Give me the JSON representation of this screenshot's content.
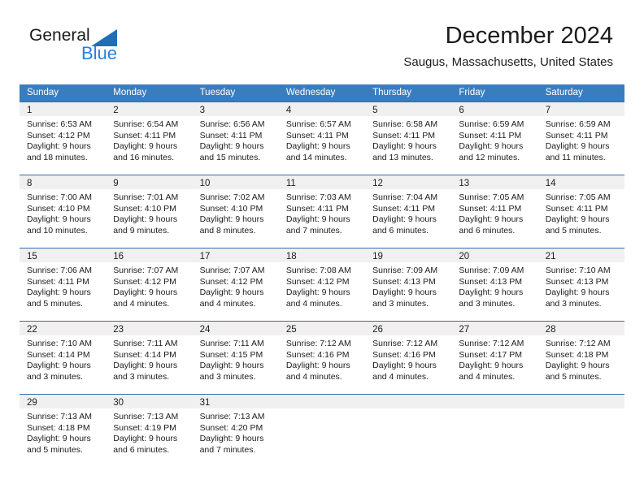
{
  "brand": {
    "name_part1": "General",
    "name_part2": "Blue",
    "triangle_color": "#1f6fb5",
    "blue_text_color": "#2980d9"
  },
  "header": {
    "title": "December 2024",
    "subtitle": "Saugus, Massachusetts, United States"
  },
  "theme": {
    "header_bar_color": "#3a7dbf",
    "row_divider_color": "#2f6fae",
    "day_band_color": "#f0f0f0",
    "text_color": "#1c1c1c"
  },
  "weekdays": [
    "Sunday",
    "Monday",
    "Tuesday",
    "Wednesday",
    "Thursday",
    "Friday",
    "Saturday"
  ],
  "weeks": [
    [
      {
        "day": "1",
        "sunrise": "Sunrise: 6:53 AM",
        "sunset": "Sunset: 4:12 PM",
        "daylight1": "Daylight: 9 hours",
        "daylight2": "and 18 minutes."
      },
      {
        "day": "2",
        "sunrise": "Sunrise: 6:54 AM",
        "sunset": "Sunset: 4:11 PM",
        "daylight1": "Daylight: 9 hours",
        "daylight2": "and 16 minutes."
      },
      {
        "day": "3",
        "sunrise": "Sunrise: 6:56 AM",
        "sunset": "Sunset: 4:11 PM",
        "daylight1": "Daylight: 9 hours",
        "daylight2": "and 15 minutes."
      },
      {
        "day": "4",
        "sunrise": "Sunrise: 6:57 AM",
        "sunset": "Sunset: 4:11 PM",
        "daylight1": "Daylight: 9 hours",
        "daylight2": "and 14 minutes."
      },
      {
        "day": "5",
        "sunrise": "Sunrise: 6:58 AM",
        "sunset": "Sunset: 4:11 PM",
        "daylight1": "Daylight: 9 hours",
        "daylight2": "and 13 minutes."
      },
      {
        "day": "6",
        "sunrise": "Sunrise: 6:59 AM",
        "sunset": "Sunset: 4:11 PM",
        "daylight1": "Daylight: 9 hours",
        "daylight2": "and 12 minutes."
      },
      {
        "day": "7",
        "sunrise": "Sunrise: 6:59 AM",
        "sunset": "Sunset: 4:11 PM",
        "daylight1": "Daylight: 9 hours",
        "daylight2": "and 11 minutes."
      }
    ],
    [
      {
        "day": "8",
        "sunrise": "Sunrise: 7:00 AM",
        "sunset": "Sunset: 4:10 PM",
        "daylight1": "Daylight: 9 hours",
        "daylight2": "and 10 minutes."
      },
      {
        "day": "9",
        "sunrise": "Sunrise: 7:01 AM",
        "sunset": "Sunset: 4:10 PM",
        "daylight1": "Daylight: 9 hours",
        "daylight2": "and 9 minutes."
      },
      {
        "day": "10",
        "sunrise": "Sunrise: 7:02 AM",
        "sunset": "Sunset: 4:10 PM",
        "daylight1": "Daylight: 9 hours",
        "daylight2": "and 8 minutes."
      },
      {
        "day": "11",
        "sunrise": "Sunrise: 7:03 AM",
        "sunset": "Sunset: 4:11 PM",
        "daylight1": "Daylight: 9 hours",
        "daylight2": "and 7 minutes."
      },
      {
        "day": "12",
        "sunrise": "Sunrise: 7:04 AM",
        "sunset": "Sunset: 4:11 PM",
        "daylight1": "Daylight: 9 hours",
        "daylight2": "and 6 minutes."
      },
      {
        "day": "13",
        "sunrise": "Sunrise: 7:05 AM",
        "sunset": "Sunset: 4:11 PM",
        "daylight1": "Daylight: 9 hours",
        "daylight2": "and 6 minutes."
      },
      {
        "day": "14",
        "sunrise": "Sunrise: 7:05 AM",
        "sunset": "Sunset: 4:11 PM",
        "daylight1": "Daylight: 9 hours",
        "daylight2": "and 5 minutes."
      }
    ],
    [
      {
        "day": "15",
        "sunrise": "Sunrise: 7:06 AM",
        "sunset": "Sunset: 4:11 PM",
        "daylight1": "Daylight: 9 hours",
        "daylight2": "and 5 minutes."
      },
      {
        "day": "16",
        "sunrise": "Sunrise: 7:07 AM",
        "sunset": "Sunset: 4:12 PM",
        "daylight1": "Daylight: 9 hours",
        "daylight2": "and 4 minutes."
      },
      {
        "day": "17",
        "sunrise": "Sunrise: 7:07 AM",
        "sunset": "Sunset: 4:12 PM",
        "daylight1": "Daylight: 9 hours",
        "daylight2": "and 4 minutes."
      },
      {
        "day": "18",
        "sunrise": "Sunrise: 7:08 AM",
        "sunset": "Sunset: 4:12 PM",
        "daylight1": "Daylight: 9 hours",
        "daylight2": "and 4 minutes."
      },
      {
        "day": "19",
        "sunrise": "Sunrise: 7:09 AM",
        "sunset": "Sunset: 4:13 PM",
        "daylight1": "Daylight: 9 hours",
        "daylight2": "and 3 minutes."
      },
      {
        "day": "20",
        "sunrise": "Sunrise: 7:09 AM",
        "sunset": "Sunset: 4:13 PM",
        "daylight1": "Daylight: 9 hours",
        "daylight2": "and 3 minutes."
      },
      {
        "day": "21",
        "sunrise": "Sunrise: 7:10 AM",
        "sunset": "Sunset: 4:13 PM",
        "daylight1": "Daylight: 9 hours",
        "daylight2": "and 3 minutes."
      }
    ],
    [
      {
        "day": "22",
        "sunrise": "Sunrise: 7:10 AM",
        "sunset": "Sunset: 4:14 PM",
        "daylight1": "Daylight: 9 hours",
        "daylight2": "and 3 minutes."
      },
      {
        "day": "23",
        "sunrise": "Sunrise: 7:11 AM",
        "sunset": "Sunset: 4:14 PM",
        "daylight1": "Daylight: 9 hours",
        "daylight2": "and 3 minutes."
      },
      {
        "day": "24",
        "sunrise": "Sunrise: 7:11 AM",
        "sunset": "Sunset: 4:15 PM",
        "daylight1": "Daylight: 9 hours",
        "daylight2": "and 3 minutes."
      },
      {
        "day": "25",
        "sunrise": "Sunrise: 7:12 AM",
        "sunset": "Sunset: 4:16 PM",
        "daylight1": "Daylight: 9 hours",
        "daylight2": "and 4 minutes."
      },
      {
        "day": "26",
        "sunrise": "Sunrise: 7:12 AM",
        "sunset": "Sunset: 4:16 PM",
        "daylight1": "Daylight: 9 hours",
        "daylight2": "and 4 minutes."
      },
      {
        "day": "27",
        "sunrise": "Sunrise: 7:12 AM",
        "sunset": "Sunset: 4:17 PM",
        "daylight1": "Daylight: 9 hours",
        "daylight2": "and 4 minutes."
      },
      {
        "day": "28",
        "sunrise": "Sunrise: 7:12 AM",
        "sunset": "Sunset: 4:18 PM",
        "daylight1": "Daylight: 9 hours",
        "daylight2": "and 5 minutes."
      }
    ],
    [
      {
        "day": "29",
        "sunrise": "Sunrise: 7:13 AM",
        "sunset": "Sunset: 4:18 PM",
        "daylight1": "Daylight: 9 hours",
        "daylight2": "and 5 minutes."
      },
      {
        "day": "30",
        "sunrise": "Sunrise: 7:13 AM",
        "sunset": "Sunset: 4:19 PM",
        "daylight1": "Daylight: 9 hours",
        "daylight2": "and 6 minutes."
      },
      {
        "day": "31",
        "sunrise": "Sunrise: 7:13 AM",
        "sunset": "Sunset: 4:20 PM",
        "daylight1": "Daylight: 9 hours",
        "daylight2": "and 7 minutes."
      },
      {
        "day": "",
        "sunrise": "",
        "sunset": "",
        "daylight1": "",
        "daylight2": ""
      },
      {
        "day": "",
        "sunrise": "",
        "sunset": "",
        "daylight1": "",
        "daylight2": ""
      },
      {
        "day": "",
        "sunrise": "",
        "sunset": "",
        "daylight1": "",
        "daylight2": ""
      },
      {
        "day": "",
        "sunrise": "",
        "sunset": "",
        "daylight1": "",
        "daylight2": ""
      }
    ]
  ]
}
